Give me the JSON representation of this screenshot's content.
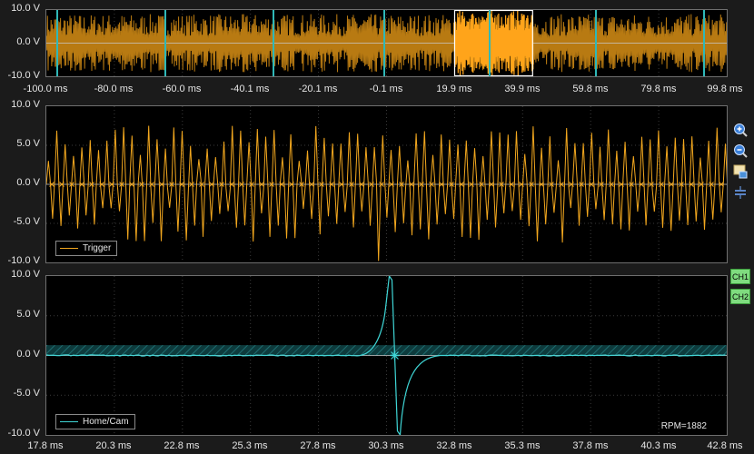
{
  "overview": {
    "y_labels": [
      "10.0 V",
      "0.0 V",
      "-10.0 V"
    ],
    "x_labels": [
      "-100.0 ms",
      "-80.0 ms",
      "-60.0 ms",
      "-40.1 ms",
      "-20.1 ms",
      "-0.1 ms",
      "19.9 ms",
      "39.9 ms",
      "59.8 ms",
      "79.8 ms",
      "99.8 ms"
    ],
    "window_start_ms": 19.9,
    "window_end_ms": 42.8
  },
  "trigger_panel": {
    "y_labels": [
      "10.0 V",
      "5.0 V",
      "0.0 V",
      "-5.0 V",
      "-10.0 V"
    ],
    "legend": "Trigger",
    "color": "#f2a71e"
  },
  "cam_panel": {
    "y_labels": [
      "10.0 V",
      "5.0 V",
      "0.0 V",
      "-5.0 V",
      "-10.0 V"
    ],
    "legend": "Home/Cam",
    "color": "#3fd6d6",
    "rpm": "RPM=1882"
  },
  "x_labels": [
    "17.8 ms",
    "20.3 ms",
    "22.8 ms",
    "25.3 ms",
    "27.8 ms",
    "30.3 ms",
    "32.8 ms",
    "35.3 ms",
    "37.8 ms",
    "40.3 ms",
    "42.8 ms"
  ],
  "toolbar": {
    "zoom_in_icon": "zoom-in-icon",
    "zoom_out_icon": "zoom-out-icon",
    "snapshot_icon": "snapshot-icon",
    "split_icon": "split-icon"
  },
  "channels": {
    "ch1": "CH1",
    "ch2": "CH2"
  },
  "chart_data": {
    "type": "line",
    "x_range_ms": [
      17.8,
      42.8
    ],
    "ylim": [
      -10,
      10
    ],
    "series": [
      {
        "name": "Trigger",
        "amplitude_v": 7.5
      },
      {
        "name": "Home/Cam",
        "peak_v": 10,
        "trough_v": -10,
        "event_ms": 30.6
      }
    ]
  }
}
